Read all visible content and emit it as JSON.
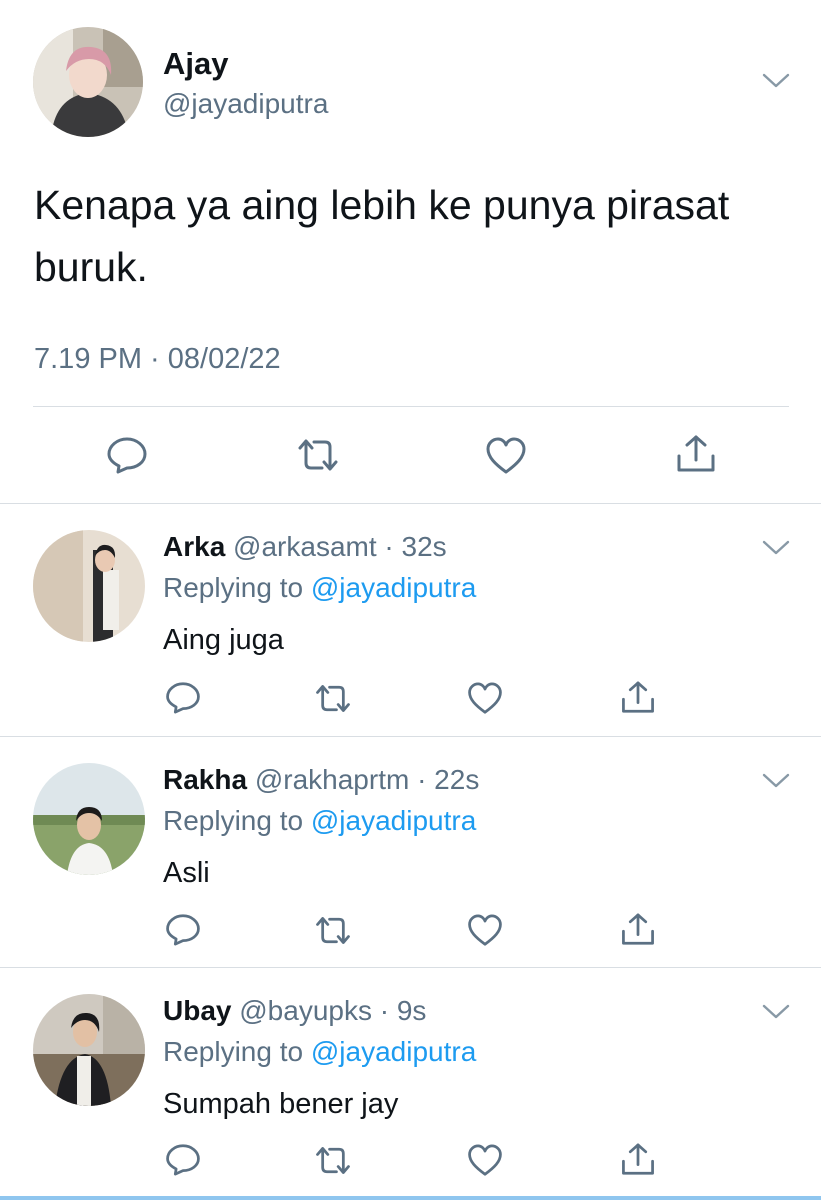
{
  "main_tweet": {
    "author_name": "Ajay",
    "author_handle": "@jayadiputra",
    "text": "Kenapa ya aing lebih ke punya pirasat buruk.",
    "timestamp": "7.19 PM · 08/02/22",
    "actions": [
      "reply-icon",
      "retweet-icon",
      "like-icon",
      "share-icon"
    ]
  },
  "replies": [
    {
      "name": "Arka",
      "handle": "@arkasamt",
      "time": "· 32s",
      "replying_prefix": "Replying to ",
      "replying_to": "@jayadiputra",
      "text": "Aing juga"
    },
    {
      "name": "Rakha",
      "handle": "@rakhaprtm",
      "time": "· 22s",
      "replying_prefix": "Replying to ",
      "replying_to": "@jayadiputra",
      "text": "Asli"
    },
    {
      "name": "Ubay",
      "handle": "@bayupks",
      "time": "· 9s",
      "replying_prefix": "Replying to ",
      "replying_to": "@jayadiputra",
      "text": "Sumpah bener jay"
    }
  ],
  "colors": {
    "text": "#0f1419",
    "secondary": "#5b7083",
    "mention": "#1d9bf0",
    "divider": "#d9dee3"
  }
}
